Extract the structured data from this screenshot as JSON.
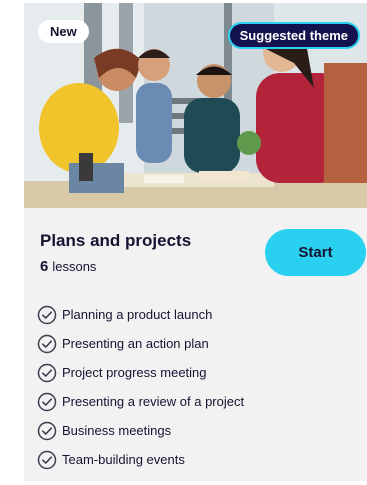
{
  "badges": {
    "new": "New",
    "suggested": "Suggested theme"
  },
  "course": {
    "title": "Plans and projects",
    "lesson_count": "6",
    "lesson_unit": "lessons",
    "start_label": "Start"
  },
  "lessons": [
    "Planning a product launch",
    "Presenting an action plan",
    "Project progress meeting",
    "Presenting a review of a project",
    "Business meetings",
    "Team-building events"
  ],
  "colors": {
    "accent": "#2ad0f0",
    "navy": "#13124e",
    "text": "#141432",
    "card_bg": "#f2f2f2"
  },
  "icons": {
    "lesson_status": "check-circle-icon"
  }
}
